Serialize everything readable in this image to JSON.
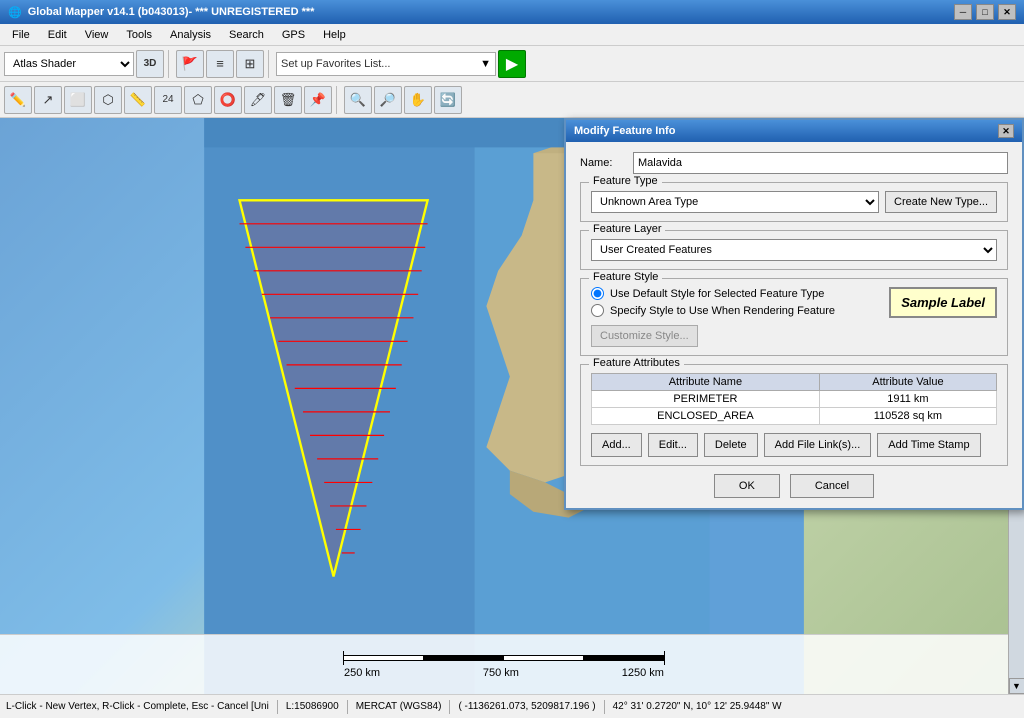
{
  "titlebar": {
    "title": "Global Mapper v14.1 (b043013)- *** UNREGISTERED ***",
    "icon": "globe-icon"
  },
  "menubar": {
    "items": [
      "File",
      "Edit",
      "View",
      "Tools",
      "Analysis",
      "Search",
      "GPS",
      "Help"
    ]
  },
  "toolbar1": {
    "favorites_placeholder": "Set up Favorites List..."
  },
  "toolbar2": {
    "shader_label": "Atlas Shader"
  },
  "dialog": {
    "title": "Modify Feature Info",
    "name_label": "Name:",
    "name_value": "Malavida",
    "feature_type_group": "Feature Type",
    "feature_type_value": "Unknown Area Type",
    "create_new_btn": "Create New Type...",
    "feature_layer_group": "Feature Layer",
    "feature_layer_value": "User Created Features",
    "feature_style_group": "Feature Style",
    "radio1_label": "Use Default Style for Selected Feature Type",
    "radio2_label": "Specify Style to Use When Rendering Feature",
    "customize_btn": "Customize Style...",
    "sample_label": "Sample Label",
    "feature_attr_group": "Feature Attributes",
    "attr_col1": "Attribute Name",
    "attr_col2": "Attribute Value",
    "attributes": [
      {
        "name": "PERIMETER",
        "value": "1911 km"
      },
      {
        "name": "ENCLOSED_AREA",
        "value": "110528 sq km"
      }
    ],
    "btn_add": "Add...",
    "btn_edit": "Edit...",
    "btn_delete": "Delete",
    "btn_add_file_link": "Add File Link(s)...",
    "btn_add_time_stamp": "Add Time Stamp",
    "btn_ok": "OK",
    "btn_cancel": "Cancel"
  },
  "status_bar": {
    "left": "L-Click - New Vertex, R-Click - Complete, Esc - Cancel [Uni",
    "scale": "L:15086900",
    "proj": "MERCAT (WGS84)",
    "coords": "( -1136261.073, 5209817.196 )",
    "latlon": "42° 31' 0.2720\" N, 10° 12' 25.9448\" W"
  },
  "scale_bar": {
    "labels": [
      "250 km",
      "750 km",
      "1250 km"
    ]
  }
}
